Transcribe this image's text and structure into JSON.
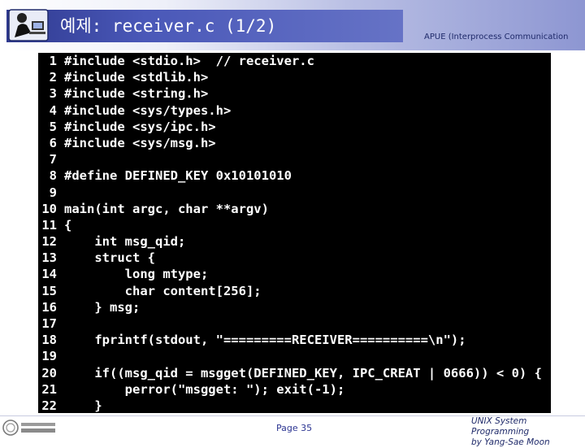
{
  "slide": {
    "title": "예제: receiver.c (1/2)",
    "header_caption": "APUE (Interprocess Communication",
    "page_label": "Page 35",
    "footer_line1": "UNIX System Programming",
    "footer_line2": "by Yang-Sae Moon"
  },
  "logos": {
    "header_icon": "person-at-computer-icon",
    "university_logo": "university-logo"
  },
  "code": {
    "lines": [
      {
        "num": "1",
        "text": "#include <stdio.h>  // receiver.c"
      },
      {
        "num": "2",
        "text": "#include <stdlib.h>"
      },
      {
        "num": "3",
        "text": "#include <string.h>"
      },
      {
        "num": "4",
        "text": "#include <sys/types.h>"
      },
      {
        "num": "5",
        "text": "#include <sys/ipc.h>"
      },
      {
        "num": "6",
        "text": "#include <sys/msg.h>"
      },
      {
        "num": "7",
        "text": ""
      },
      {
        "num": "8",
        "text": "#define DEFINED_KEY 0x10101010"
      },
      {
        "num": "9",
        "text": ""
      },
      {
        "num": "10",
        "text": "main(int argc, char **argv)"
      },
      {
        "num": "11",
        "text": "{"
      },
      {
        "num": "12",
        "text": "    int msg_qid;"
      },
      {
        "num": "13",
        "text": "    struct {"
      },
      {
        "num": "14",
        "text": "        long mtype;"
      },
      {
        "num": "15",
        "text": "        char content[256];"
      },
      {
        "num": "16",
        "text": "    } msg;"
      },
      {
        "num": "17",
        "text": ""
      },
      {
        "num": "18",
        "text": "    fprintf(stdout, \"=========RECEIVER==========\\n\");"
      },
      {
        "num": "19",
        "text": ""
      },
      {
        "num": "20",
        "text": "    if((msg_qid = msgget(DEFINED_KEY, IPC_CREAT | 0666)) < 0) {"
      },
      {
        "num": "21",
        "text": "        perror(\"msgget: \"); exit(-1);"
      },
      {
        "num": "22",
        "text": "    }"
      }
    ]
  },
  "colors": {
    "title_bar": "#3a46a6",
    "code_background": "#000000",
    "code_text": "#ffffff",
    "accent_text": "#2c3592"
  }
}
